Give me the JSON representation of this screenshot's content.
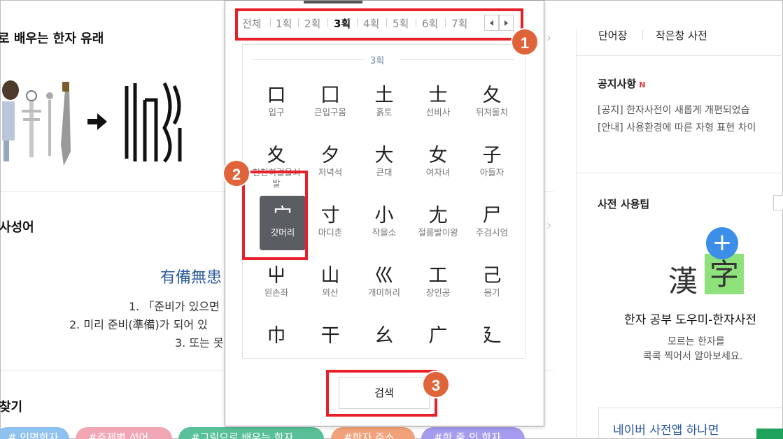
{
  "background": {
    "section1_title": "로 배우는 한자 유래",
    "section2_title": "사성어",
    "idiom": {
      "hanja": "有備無患",
      "lines": [
        "1. 「준비가 있으면",
        "2. 미리 준비(準備)가 되어 있",
        "3. 또는 못"
      ]
    },
    "section3_title": "찾기",
    "tags": [
      {
        "label": "# 인명한자",
        "color": "#8fc1ef"
      },
      {
        "label": "#주제별 성어",
        "color": "#f0a7b3"
      },
      {
        "label": "#그림으로 배우는 한자",
        "color": "#59c09a"
      },
      {
        "label": "#한자 주소",
        "color": "#f2a27a"
      },
      {
        "label": "#한 줄 의 한자",
        "color": "#a59cee"
      }
    ]
  },
  "right_panel": {
    "links": [
      "단어장",
      "작은창 사전"
    ],
    "notice_title": "공지사항",
    "notice_new_badge": "N",
    "notices": [
      "[공지] 한자사전이 새롭게 개편되었습",
      "[안내] 사용환경에 따른 자형 표현 차이"
    ],
    "tip_title": "사전 사용팁",
    "logo_left": "漢",
    "logo_right": "字",
    "plus_symbol": "+",
    "tip_heading": "한자 공부 도우미-한자사전",
    "tip_desc": [
      "모르는 한자를",
      "콕콕 찍어서 알아보세요."
    ],
    "app_promo": "네이버 사전앱 하나면"
  },
  "popup": {
    "stroke_tabs": [
      "전체",
      "1획",
      "2획",
      "3획",
      "4획",
      "5획",
      "6획",
      "7획"
    ],
    "active_tab": "3획",
    "section_label": "3획",
    "radicals": [
      {
        "glyph": "口",
        "name": "입구"
      },
      {
        "glyph": "囗",
        "name": "큰입구몸"
      },
      {
        "glyph": "土",
        "name": "흙토"
      },
      {
        "glyph": "士",
        "name": "선비사"
      },
      {
        "glyph": "夂",
        "name": "뒤져올치"
      },
      {
        "glyph": "夊",
        "name": "천천히걸을쇠발"
      },
      {
        "glyph": "夕",
        "name": "저녁석"
      },
      {
        "glyph": "大",
        "name": "큰대"
      },
      {
        "glyph": "女",
        "name": "여자녀"
      },
      {
        "glyph": "子",
        "name": "아들자"
      },
      {
        "glyph": "宀",
        "name": "갓머리",
        "selected": true
      },
      {
        "glyph": "寸",
        "name": "마디촌"
      },
      {
        "glyph": "小",
        "name": "작을소"
      },
      {
        "glyph": "尢",
        "name": "절름발이왕"
      },
      {
        "glyph": "尸",
        "name": "주검시엄"
      },
      {
        "glyph": "屮",
        "name": "왼손좌"
      },
      {
        "glyph": "山",
        "name": "뫼산"
      },
      {
        "glyph": "巛",
        "name": "개미허리"
      },
      {
        "glyph": "工",
        "name": "장인공"
      },
      {
        "glyph": "己",
        "name": "몸기"
      },
      {
        "glyph": "巾",
        "name": ""
      },
      {
        "glyph": "干",
        "name": ""
      },
      {
        "glyph": "幺",
        "name": ""
      },
      {
        "glyph": "广",
        "name": ""
      },
      {
        "glyph": "廴",
        "name": ""
      }
    ],
    "search_button": "검색"
  },
  "annotations": [
    "1",
    "2",
    "3"
  ],
  "colors": {
    "annotation_box": "#e8202a",
    "annotation_badge": "#e0643a",
    "selected_cell": "#5a5e63"
  }
}
